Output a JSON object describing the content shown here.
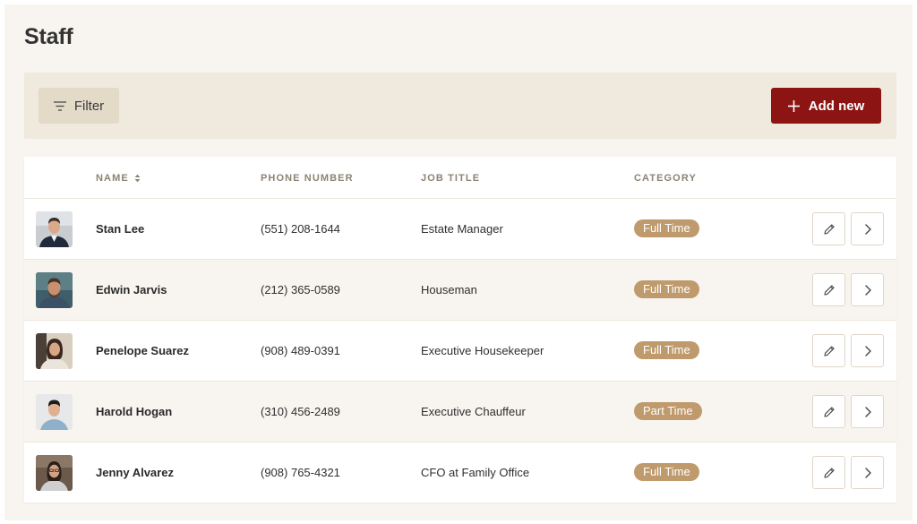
{
  "page": {
    "title": "Staff"
  },
  "toolbar": {
    "filter_label": "Filter",
    "add_label": "Add new"
  },
  "table": {
    "columns": [
      "NAME",
      "PHONE NUMBER",
      "JOB TITLE",
      "CATEGORY"
    ],
    "rows": [
      {
        "name": "Stan Lee",
        "phone": "(551) 208-1644",
        "job": "Estate Manager",
        "category": "Full Time"
      },
      {
        "name": "Edwin Jarvis",
        "phone": "(212) 365-0589",
        "job": "Houseman",
        "category": "Full Time"
      },
      {
        "name": "Penelope Suarez",
        "phone": "(908) 489-0391",
        "job": "Executive Housekeeper",
        "category": "Full Time"
      },
      {
        "name": "Harold Hogan",
        "phone": "(310) 456-2489",
        "job": "Executive Chauffeur",
        "category": "Part Time"
      },
      {
        "name": "Jenny Alvarez",
        "phone": "(908) 765-4321",
        "job": "CFO at Family Office",
        "category": "Full Time"
      }
    ]
  },
  "colors": {
    "accent": "#8c1412",
    "badge": "#bf9a6c",
    "background": "#f8f5f0",
    "toolbar": "#efe9de"
  }
}
